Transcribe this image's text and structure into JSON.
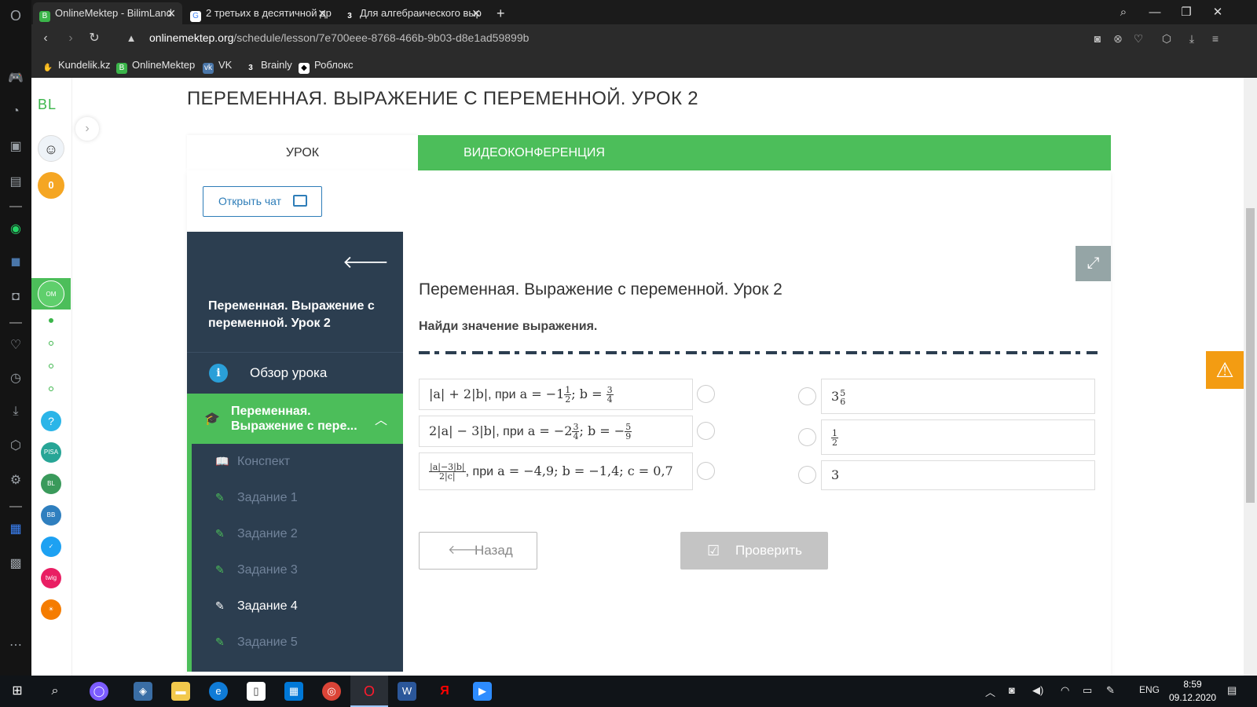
{
  "browser": {
    "tabs": [
      {
        "label": "OnlineMektep - BilimLand",
        "active": true,
        "icon": "onlinemektep-icon"
      },
      {
        "label": "2 третьих в десятичной др",
        "active": false,
        "icon": "google-icon"
      },
      {
        "label": "Для алгебраического выр",
        "active": false,
        "icon": "brainly-icon"
      }
    ],
    "new_tab": "+",
    "url_host": "onlinemektep.org",
    "url_path": "/schedule/lesson/7e700eee-8768-466b-9b03-d8e1ad59899b",
    "bookmarks": [
      "Kundelik.kz",
      "OnlineMektep",
      "VK",
      "Brainly",
      "Роблокс"
    ]
  },
  "sidebar_panel": {
    "logo": "BL",
    "badge_count": "0",
    "help": "?"
  },
  "page": {
    "title": "ПЕРЕМЕННАЯ. ВЫРАЖЕНИЕ С ПЕРЕМЕННОЙ. УРОК 2",
    "tab_lesson": "УРОК",
    "tab_video": "ВИДЕОКОНФЕРЕНЦИЯ",
    "chat_button": "Открыть чат"
  },
  "lesson_nav": {
    "title": "Переменная. Выражение с переменной. Урок 2",
    "overview": "Обзор урока",
    "active_section_line1": "Переменная.",
    "active_section_line2": "Выражение с пере...",
    "items": [
      "Конспект",
      "Задание 1",
      "Задание 2",
      "Задание 3",
      "Задание 4",
      "Задание 5"
    ],
    "current_item": "Задание 4"
  },
  "task": {
    "heading": "Переменная. Выражение с переменной. Урок 2",
    "instruction": "Найди значение выражения.",
    "expressions": [
      {
        "pre": "|a| + 2|b|",
        "word": "при",
        "cond_a": "a = −1",
        "a_frac": [
          "1",
          "2"
        ],
        "cond_b": "b = ",
        "b_frac": [
          "3",
          "4"
        ]
      },
      {
        "pre": "2|a| − 3|b|",
        "word": "при",
        "cond_a": "a = −2",
        "a_frac": [
          "3",
          "4"
        ],
        "cond_b": "b = −",
        "b_frac": [
          "5",
          "9"
        ]
      },
      {
        "pre_num": "|a|−3|b|",
        "pre_den": "2|c|",
        "word": "при",
        "cond": "a = −4,9; b = −1,4; c = 0,7"
      }
    ],
    "answers": [
      {
        "whole": "3",
        "num": "5",
        "den": "6"
      },
      {
        "whole": "",
        "num": "1",
        "den": "2"
      },
      {
        "whole": "3",
        "num": "",
        "den": ""
      }
    ],
    "back_button": "Назад",
    "check_button": "Проверить"
  },
  "taskbar": {
    "lang": "ENG",
    "time": "8:59",
    "date": "09.12.2020"
  },
  "colors": {
    "green": "#4cbe5a",
    "sidebar_dark": "#2c3e50",
    "link_blue": "#2e7db8",
    "warning": "#f39c12"
  }
}
